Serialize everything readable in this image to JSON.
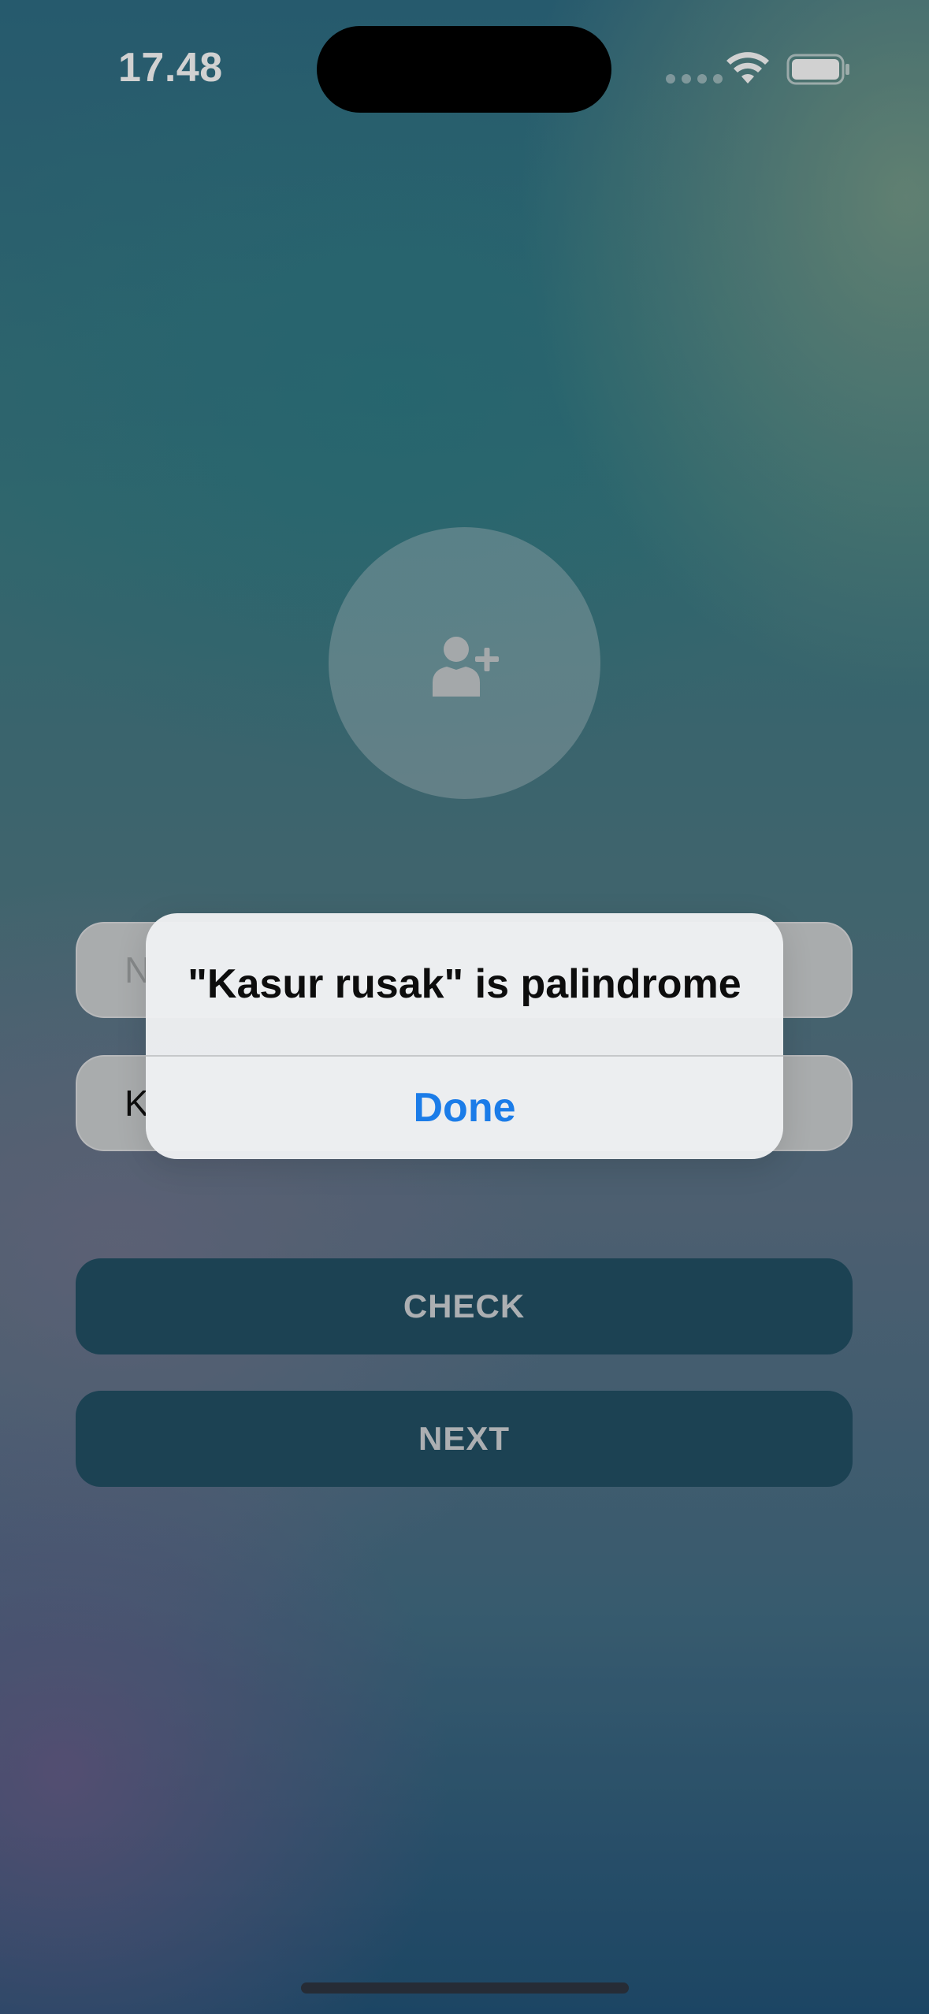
{
  "status_bar": {
    "time": "17.48",
    "icons": [
      "cellular-signal-icon",
      "wifi-icon",
      "battery-icon"
    ]
  },
  "avatar": {
    "icon": "add-user-icon"
  },
  "form": {
    "name_placeholder_visible": "N",
    "sentence_value_visible": "K"
  },
  "buttons": {
    "check_label": "CHECK",
    "next_label": "NEXT"
  },
  "alert": {
    "title": "\"Kasur rusak\" is palindrome",
    "action_label": "Done"
  },
  "colors": {
    "button_bg": "#235166",
    "alert_action": "#1b7ce8",
    "field_bg": "#cfd2d4"
  }
}
